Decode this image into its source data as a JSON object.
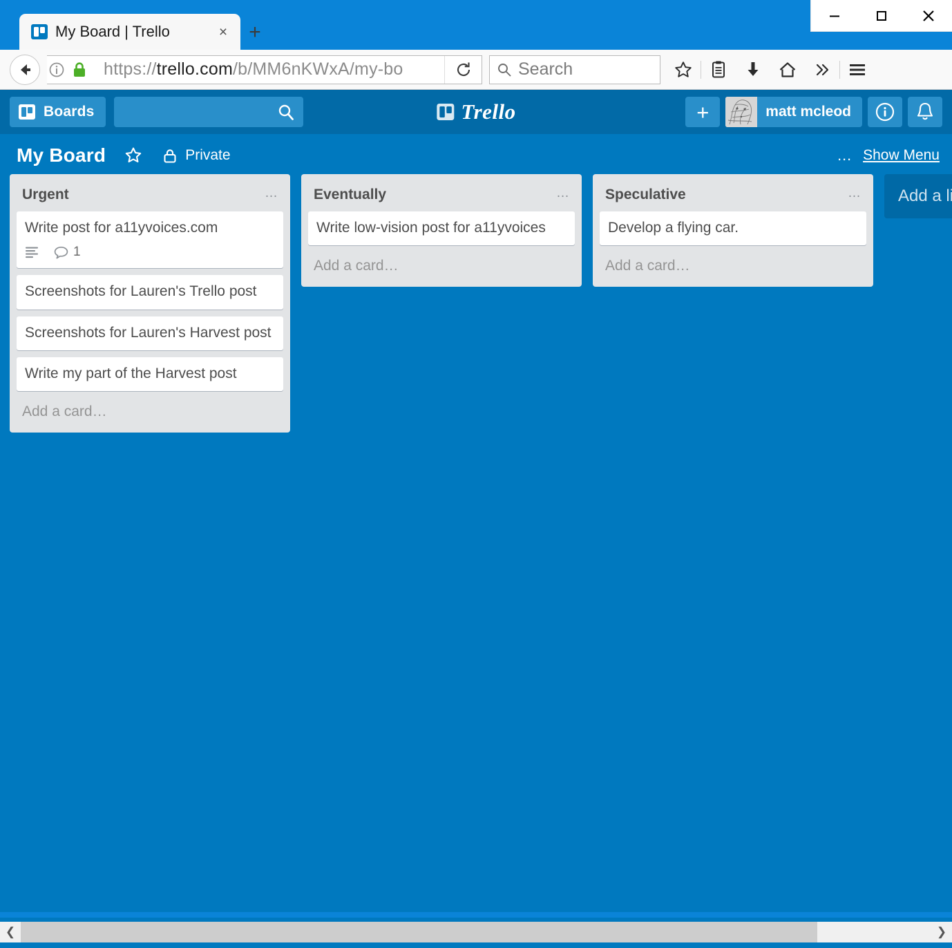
{
  "window": {
    "minimize_label": "minimize",
    "maximize_label": "maximize",
    "close_label": "close"
  },
  "browser": {
    "tab": {
      "title": "My Board | Trello",
      "favicon": "trello-icon",
      "close_label": "×"
    },
    "new_tab_label": "+",
    "url": {
      "scheme": "https://",
      "host": "trello.com",
      "path": "/b/MM6nKWxA/my-bo",
      "full": "https://trello.com/b/MM6nKWxA/my-bo"
    },
    "search_placeholder": "Search",
    "icons": {
      "back": "back-arrow-icon",
      "site_info": "info-circle-icon",
      "lock": "green-padlock-icon",
      "reload": "reload-icon",
      "search": "search-icon",
      "bookmark": "star-icon",
      "reading_list": "reading-list-icon",
      "downloads": "download-arrow-icon",
      "home": "home-icon",
      "overflow": "chevron-double-right-icon",
      "menu": "hamburger-menu-icon"
    }
  },
  "trello_header": {
    "boards_label": "Boards",
    "search_value": "",
    "logo_text": "Trello",
    "add_label": "+",
    "member_name": "matt mcleod",
    "info_label": "i",
    "notifications_label": "bell"
  },
  "board": {
    "title": "My Board",
    "visibility": "Private",
    "show_menu_label": "Show Menu",
    "dots_label": "…",
    "add_list_label": "Add a list…",
    "lists": [
      {
        "title": "Urgent",
        "add_card_label": "Add a card…",
        "cards": [
          {
            "title": "Write post for a11yvoices.com",
            "has_description": true,
            "comment_count": "1"
          },
          {
            "title": "Screenshots for Lauren's Trello post",
            "has_description": false,
            "comment_count": ""
          },
          {
            "title": "Screenshots for Lauren's Harvest post",
            "has_description": false,
            "comment_count": ""
          },
          {
            "title": "Write my part of the Harvest post",
            "has_description": false,
            "comment_count": ""
          }
        ]
      },
      {
        "title": "Eventually",
        "add_card_label": "Add a card…",
        "cards": [
          {
            "title": "Write low-vision post for a11yvoices",
            "has_description": false,
            "comment_count": ""
          }
        ]
      },
      {
        "title": "Speculative",
        "add_card_label": "Add a card…",
        "cards": [
          {
            "title": "Develop a flying car.",
            "has_description": false,
            "comment_count": ""
          }
        ]
      }
    ]
  },
  "colors": {
    "board_blue": "#0079bf",
    "header_blue": "#026aa7",
    "button_blue": "#298fca",
    "list_grey": "#e2e4e6",
    "card_white": "#ffffff",
    "text_grey": "#4d4d4d",
    "lock_green": "#4caf27"
  }
}
